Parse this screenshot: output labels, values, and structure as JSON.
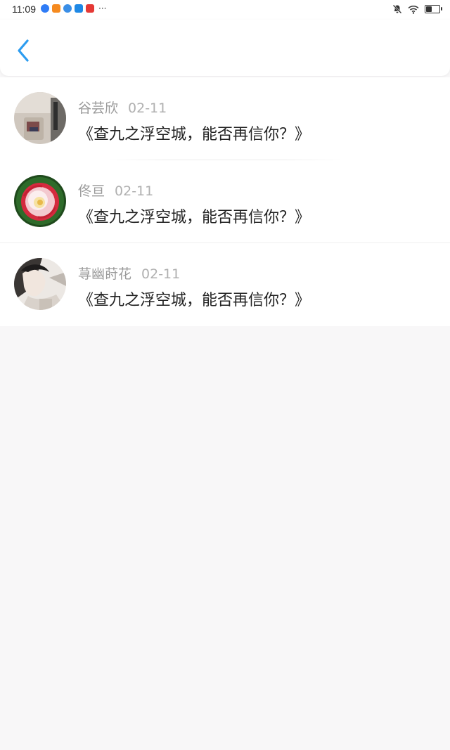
{
  "status_bar": {
    "time": "11:09",
    "more": "···",
    "battery_level": 0.45,
    "app_icons": [
      {
        "icon": "blue-circle-app-icon",
        "color": "#2f7cf6"
      },
      {
        "icon": "orange-play-app-icon",
        "color": "#f58a1f"
      },
      {
        "icon": "blue-music-app-icon",
        "color": "#3a8ee6"
      },
      {
        "icon": "blue-browser-app-icon",
        "color": "#1e88e5"
      },
      {
        "icon": "red-app-icon",
        "color": "#e53935"
      }
    ]
  },
  "header": {
    "back_icon": "chevron-left-icon",
    "accent_color": "#2c9cf0"
  },
  "comments": [
    {
      "name": "谷芸欣",
      "date": "02-11",
      "text": "《查九之浮空城，能否再信你？》"
    },
    {
      "name": "佟亘",
      "date": "02-11",
      "text": "《查九之浮空城，能否再信你？》"
    },
    {
      "name": "荨幽莳花",
      "date": "02-11",
      "text": "《查九之浮空城，能否再信你？》"
    }
  ]
}
